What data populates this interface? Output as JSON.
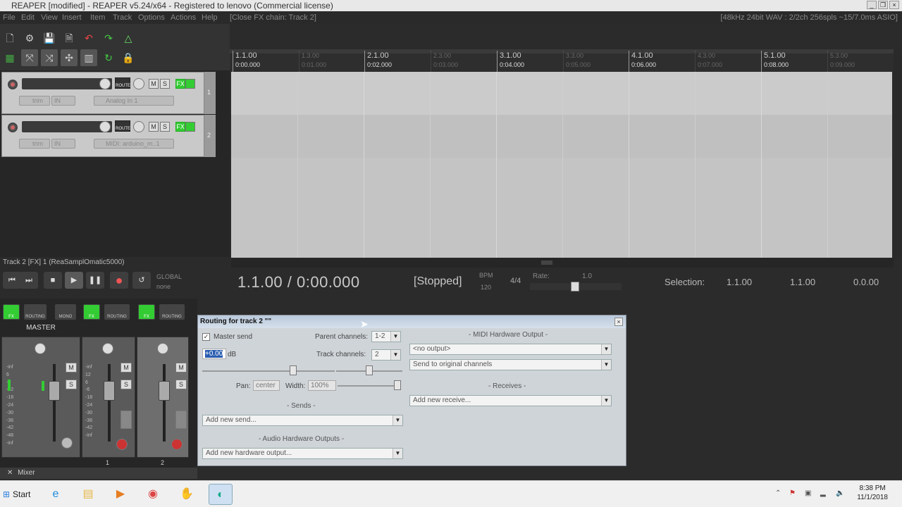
{
  "window": {
    "title": "REAPER [modified] - REAPER v5.24/x64 - Registered to lenovo (Commercial license)",
    "menu": [
      "File",
      "Edit",
      "View",
      "Insert",
      "Item",
      "Track",
      "Options",
      "Actions",
      "Help",
      "[Close FX chain: Track 2]"
    ],
    "audio_status": "[48kHz 24bit WAV : 2/2ch 256spls ~15/7.0ms ASIO]"
  },
  "tracks": [
    {
      "number": "1",
      "mute": "M",
      "solo": "S",
      "fx": "FX",
      "route": "ROUTE",
      "trim": "trim",
      "in": "IN",
      "input": "Analog In 1"
    },
    {
      "number": "2",
      "mute": "M",
      "solo": "S",
      "fx": "FX",
      "route": "ROUTE",
      "trim": "trim",
      "in": "IN",
      "input": "MIDI: arduino_m..1"
    }
  ],
  "ruler": [
    {
      "bar": "1.1.00",
      "time": "0:00.000",
      "major": true
    },
    {
      "bar": "1.3.00",
      "time": "0:01.000",
      "major": false
    },
    {
      "bar": "2.1.00",
      "time": "0:02.000",
      "major": true
    },
    {
      "bar": "2.3.00",
      "time": "0:03.000",
      "major": false
    },
    {
      "bar": "3.1.00",
      "time": "0:04.000",
      "major": true
    },
    {
      "bar": "3.3.00",
      "time": "0:05.000",
      "major": false
    },
    {
      "bar": "4.1.00",
      "time": "0:06.000",
      "major": true
    },
    {
      "bar": "4.3.00",
      "time": "0:07.000",
      "major": false
    },
    {
      "bar": "5.1.00",
      "time": "0:08.000",
      "major": true
    },
    {
      "bar": "5.3.00",
      "time": "0:09.000",
      "major": false
    }
  ],
  "transport": {
    "track_label": "Track 2 [FX] 1 (ReaSamplOmatic5000)",
    "global": "GLOBAL",
    "none": "none",
    "position": "1.1.00 / 0:00.000",
    "state": "[Stopped]",
    "bpm_label": "BPM",
    "bpm": "120",
    "time_sig": "4/4",
    "rate_label": "Rate:",
    "rate": "1.0",
    "selection_label": "Selection:",
    "sel_start": "1.1.00",
    "sel_end": "1.1.00",
    "sel_len": "0.0.00"
  },
  "mixer": {
    "master_label": "MASTER",
    "heads": [
      {
        "fx": "FX",
        "routing": "ROUTING",
        "mono": "MONO"
      },
      {
        "fx": "FX",
        "routing": "ROUTING"
      },
      {
        "fx": "FX",
        "routing": "ROUTING"
      }
    ],
    "meter_scale": [
      "-inf",
      "6",
      "-6",
      "-12",
      "-18",
      "-24",
      "-30",
      "-36",
      "-42",
      "-48",
      "-inf"
    ],
    "meter_scale_right": [
      "-inf",
      "12",
      "6",
      "-6",
      "-18",
      "-24",
      "-30",
      "-36",
      "-42",
      "-inf"
    ],
    "strip_numbers": [
      "1",
      "2"
    ],
    "tab": "Mixer",
    "m": "M",
    "s": "S"
  },
  "dialog": {
    "title": "Routing for track 2 \"\"",
    "master_send": "Master send",
    "parent_channels_label": "Parent channels:",
    "parent_channels": "1-2",
    "track_channels_label": "Track channels:",
    "track_channels": "2",
    "volume": "+0.00",
    "volume_unit": "dB",
    "pan_label": "Pan:",
    "pan": "center",
    "width_label": "Width:",
    "width": "100%",
    "sends_header": "- Sends -",
    "add_send": "Add new send...",
    "audio_hw_header": "- Audio Hardware Outputs -",
    "add_hw": "Add new hardware output...",
    "midi_hw_header": "- MIDI Hardware Output -",
    "midi_out": "<no output>",
    "midi_channels": "Send to original channels",
    "receives_header": "- Receives -",
    "add_receive": "Add new receive..."
  },
  "taskbar": {
    "start": "Start",
    "time": "8:38 PM",
    "date": "11/1/2018"
  }
}
